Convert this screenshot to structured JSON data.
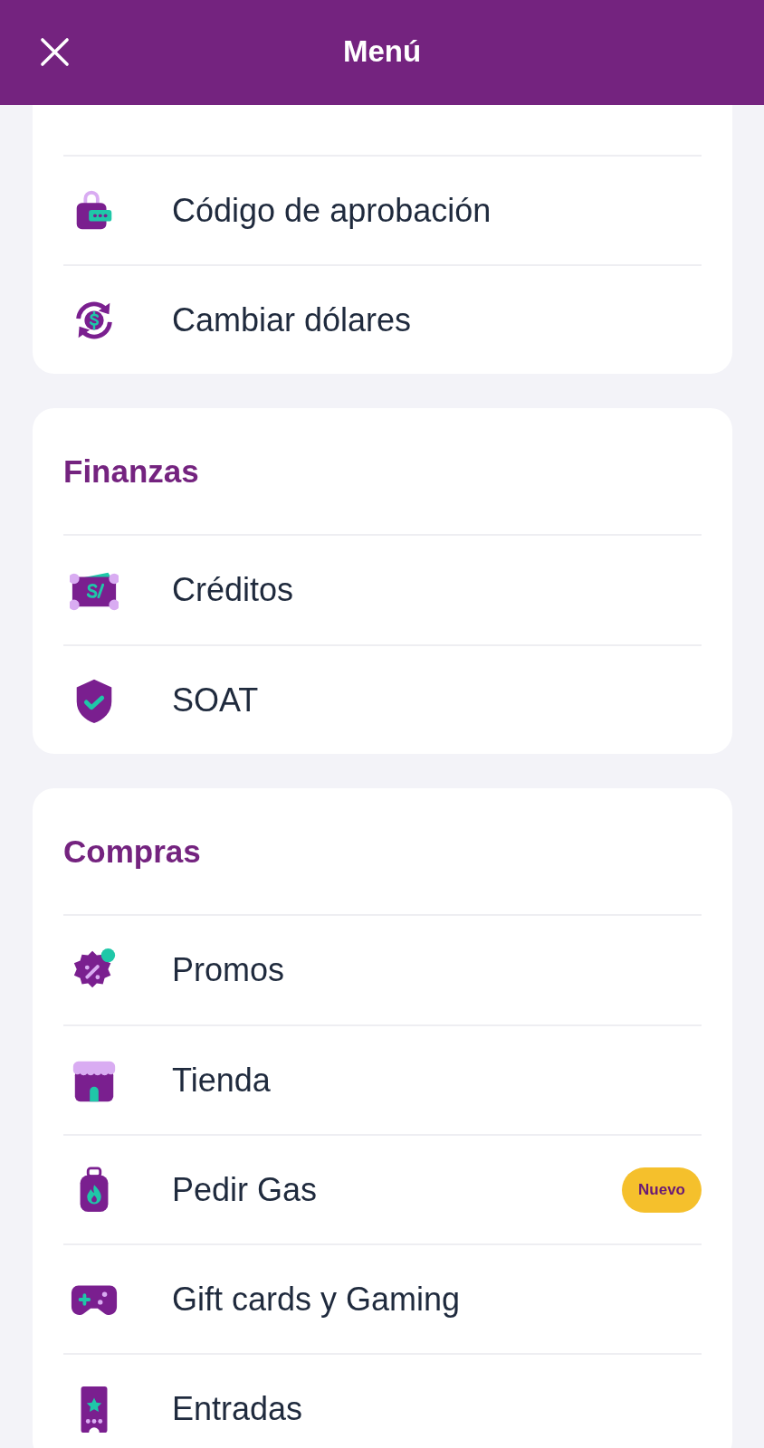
{
  "header": {
    "title": "Menú"
  },
  "sections": [
    {
      "items": [
        {
          "label": "Código de aprobación"
        },
        {
          "label": "Cambiar dólares"
        }
      ]
    },
    {
      "title": "Finanzas",
      "items": [
        {
          "label": "Créditos"
        },
        {
          "label": "SOAT"
        }
      ]
    },
    {
      "title": "Compras",
      "items": [
        {
          "label": "Promos"
        },
        {
          "label": "Tienda"
        },
        {
          "label": "Pedir Gas",
          "badge": "Nuevo"
        },
        {
          "label": "Gift cards y Gaming"
        },
        {
          "label": "Entradas"
        }
      ]
    }
  ]
}
